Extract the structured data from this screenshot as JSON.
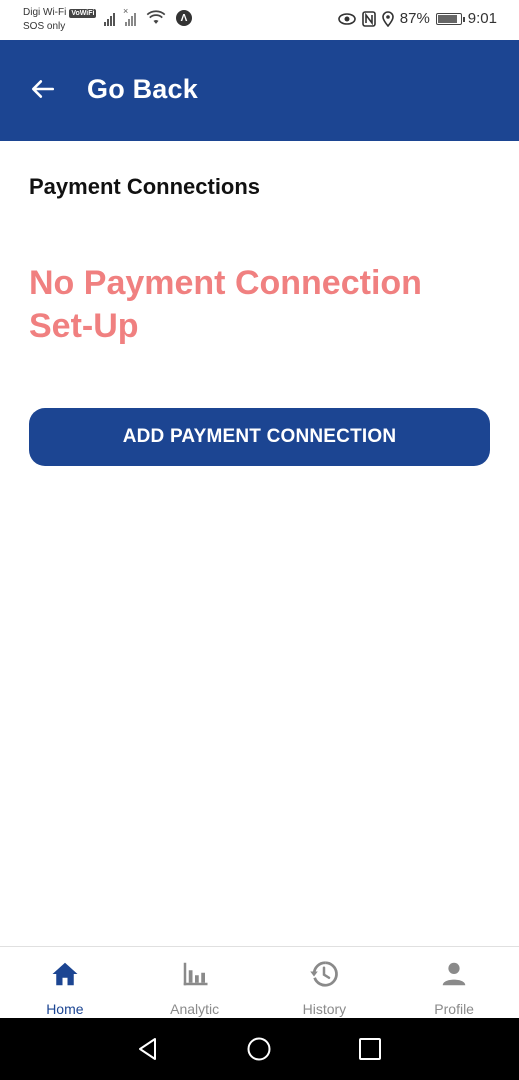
{
  "status_bar": {
    "carrier": "Digi Wi-Fi",
    "vowifi_badge": "VoWiFi",
    "sos_text": "SOS only",
    "battery_percent": "87%",
    "battery_level": 0.87,
    "time": "9:01",
    "icons": [
      "signal-icon",
      "signal-x-icon",
      "wifi-icon",
      "anchor-icon",
      "eye-icon",
      "nfc-icon",
      "location-icon",
      "battery-icon"
    ]
  },
  "app_bar": {
    "title": "Go Back",
    "background_color": "#1c4592"
  },
  "content": {
    "section_title": "Payment Connections",
    "empty_message": "No Payment Connection Set-Up",
    "empty_message_color": "#f08080",
    "add_button_label": "ADD PAYMENT CONNECTION"
  },
  "bottom_nav": {
    "active_color": "#1c4592",
    "inactive_color": "#8a8a8a",
    "items": [
      {
        "label": "Home",
        "icon": "home-icon",
        "active": true
      },
      {
        "label": "Analytic",
        "icon": "bar-chart-icon",
        "active": false
      },
      {
        "label": "History",
        "icon": "history-icon",
        "active": false
      },
      {
        "label": "Profile",
        "icon": "person-icon",
        "active": false
      }
    ]
  },
  "system_nav": {
    "buttons": [
      "back-triangle-icon",
      "home-circle-icon",
      "recents-square-icon"
    ]
  }
}
